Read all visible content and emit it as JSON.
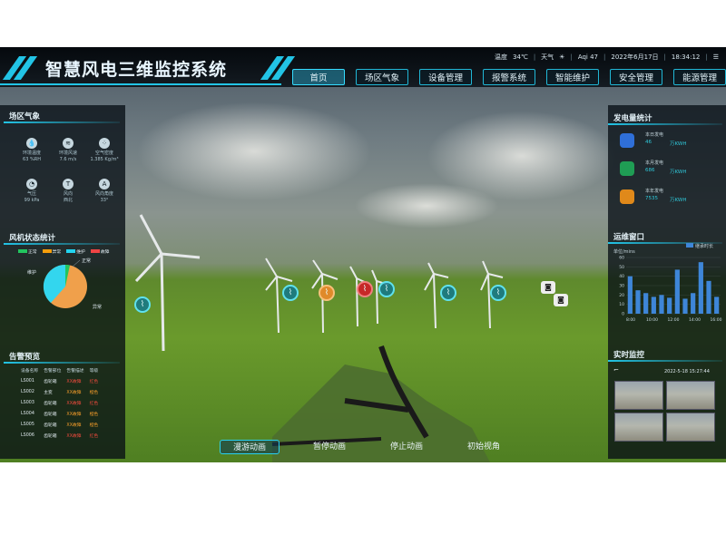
{
  "app": {
    "title": "智慧风电三维监控系统"
  },
  "status": {
    "temp_label": "温度",
    "temp_value": "34℃",
    "weather_label": "天气",
    "weather_icon": "sun-icon",
    "aqi": "Aqi 47",
    "date": "2022年6月17日",
    "time": "18:34:12"
  },
  "nav": {
    "items": [
      {
        "label": "首页"
      },
      {
        "label": "场区气象"
      },
      {
        "label": "设备管理"
      },
      {
        "label": "报警系统"
      },
      {
        "label": "智能维护"
      },
      {
        "label": "安全管理"
      },
      {
        "label": "能源管理"
      }
    ],
    "active": "首页"
  },
  "weather": {
    "title": "场区气象",
    "items": [
      {
        "icon": "humidity-icon",
        "name": "环境温度",
        "value": "63 %RH"
      },
      {
        "icon": "wind-icon",
        "name": "环境风速",
        "value": "7.6 m/s"
      },
      {
        "icon": "air-density-icon",
        "name": "空气密度",
        "value": "1.385 Kg/m³"
      },
      {
        "icon": "pressure-icon",
        "name": "气压",
        "value": "99 kPa"
      },
      {
        "icon": "wind-direction-icon",
        "name": "风向",
        "value": "西北"
      },
      {
        "icon": "wind-angle-icon",
        "name": "风向角度",
        "value": "33°"
      }
    ]
  },
  "turbine_status": {
    "title": "风机状态统计",
    "legend": [
      {
        "label": "正常",
        "color": "#22c55e"
      },
      {
        "label": "异常",
        "color": "#f59e0b"
      },
      {
        "label": "维护",
        "color": "#22d3ee"
      },
      {
        "label": "故障",
        "color": "#ef4444"
      }
    ],
    "slice_labels": {
      "a": "正常",
      "b": "维护",
      "c": "异常"
    },
    "colors": {
      "maintenance": "#33d6ee",
      "abnormal": "#f0a04b",
      "normal": "#22c55e"
    }
  },
  "alerts": {
    "title": "告警预览",
    "headers": [
      "设备名称",
      "告警部位",
      "告警描述",
      "等级"
    ],
    "rows": [
      [
        "LS001",
        "齿轮箱",
        "XX故障",
        "红色"
      ],
      [
        "LS002",
        "主变",
        "XX故障",
        "橙色"
      ],
      [
        "LS003",
        "齿轮箱",
        "XX故障",
        "红色"
      ],
      [
        "LS004",
        "齿轮箱",
        "XX故障",
        "橙色"
      ],
      [
        "LS005",
        "齿轮箱",
        "XX故障",
        "橙色"
      ],
      [
        "LS006",
        "齿轮箱",
        "XX故障",
        "红色"
      ]
    ]
  },
  "generation": {
    "title": "发电量统计",
    "items": [
      {
        "name": "本日发电",
        "value": "46",
        "unit": "万KWH",
        "color": "#3b82f6"
      },
      {
        "name": "本月发电",
        "value": "686",
        "unit": "万KWH",
        "color": "#22c55e"
      },
      {
        "name": "本年发电",
        "value": "7535",
        "unit": "万KWH",
        "color": "#f59e0b"
      }
    ]
  },
  "ops": {
    "title": "运维窗口",
    "legend": "继承时长",
    "ylabel": "单位/mins"
  },
  "monitor": {
    "title": "实时监控",
    "timestamp": "2022-5-18 15:27:44"
  },
  "bottom": {
    "buttons": [
      {
        "label": "漫游动画"
      },
      {
        "label": "暂停动画"
      },
      {
        "label": "停止动画"
      },
      {
        "label": "初始视角"
      }
    ]
  },
  "chart_data": {
    "type": "bar",
    "x": [
      "8:00",
      "10:00",
      "12:00",
      "14:00",
      "16:00"
    ],
    "values": [
      40,
      25,
      22,
      18,
      20,
      17,
      47,
      16,
      22,
      55,
      35,
      18
    ],
    "ylim": [
      0,
      60
    ],
    "yticks": [
      0,
      10,
      20,
      30,
      40,
      50,
      60
    ],
    "series_name": "继承时长",
    "color": "#3e86d8"
  }
}
